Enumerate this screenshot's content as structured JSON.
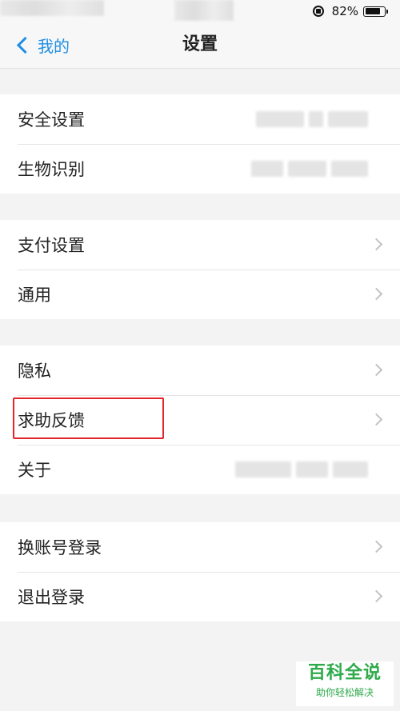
{
  "status_bar": {
    "battery_percent": "82%",
    "battery_level": 0.82,
    "icons": [
      "rotation-lock-icon",
      "battery-icon"
    ]
  },
  "nav": {
    "back_label": "我的",
    "title": "设置"
  },
  "groups": [
    {
      "items": [
        {
          "label": "安全设置"
        },
        {
          "label": "生物识别"
        }
      ]
    },
    {
      "items": [
        {
          "label": "支付设置"
        },
        {
          "label": "通用"
        }
      ]
    },
    {
      "items": [
        {
          "label": "隐私"
        },
        {
          "label": "求助反馈"
        },
        {
          "label": "关于"
        }
      ]
    },
    {
      "items": [
        {
          "label": "换账号登录"
        },
        {
          "label": "退出登录"
        }
      ]
    }
  ],
  "colors": {
    "accent": "#1f8fe5",
    "highlight": "#e3262a",
    "watermark": "#2eaa4a"
  },
  "watermark": {
    "title": "百科全说",
    "subtitle": "助你轻松解决"
  }
}
